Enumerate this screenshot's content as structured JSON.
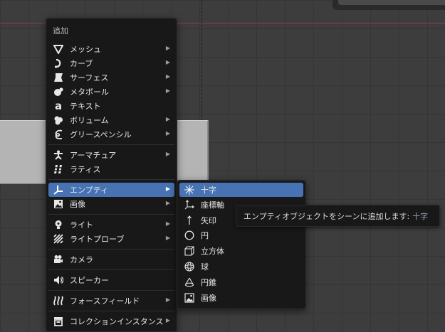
{
  "menu": {
    "title": "追加",
    "items": [
      {
        "label": "メッシュ",
        "icon": "mesh-icon",
        "submenu": true
      },
      {
        "label": "カーブ",
        "icon": "curve-icon",
        "submenu": true
      },
      {
        "label": "サーフェス",
        "icon": "surface-icon",
        "submenu": true
      },
      {
        "label": "メタボール",
        "icon": "metaball-icon",
        "submenu": true
      },
      {
        "label": "テキスト",
        "icon": "text-icon",
        "submenu": false
      },
      {
        "label": "ボリューム",
        "icon": "volume-icon",
        "submenu": true
      },
      {
        "label": "グリースペンシル",
        "icon": "grease-pencil-icon",
        "submenu": true
      },
      {
        "label": "アーマチュア",
        "icon": "armature-icon",
        "submenu": true
      },
      {
        "label": "ラティス",
        "icon": "lattice-icon",
        "submenu": false
      },
      {
        "label": "エンプティ",
        "icon": "empty-icon",
        "submenu": true,
        "active": true
      },
      {
        "label": "画像",
        "icon": "image-icon",
        "submenu": true
      },
      {
        "label": "ライト",
        "icon": "light-icon",
        "submenu": true
      },
      {
        "label": "ライトプローブ",
        "icon": "light-probe-icon",
        "submenu": true
      },
      {
        "label": "カメラ",
        "icon": "camera-icon",
        "submenu": false
      },
      {
        "label": "スピーカー",
        "icon": "speaker-icon",
        "submenu": false
      },
      {
        "label": "フォースフィールド",
        "icon": "force-field-icon",
        "submenu": true
      },
      {
        "label": "コレクションインスタンス",
        "icon": "collection-instance-icon",
        "submenu": true
      }
    ]
  },
  "submenu": {
    "items": [
      {
        "label": "十字",
        "icon": "plain-axes-icon",
        "active": true
      },
      {
        "label": "座標軸",
        "icon": "arrows-icon"
      },
      {
        "label": "矢印",
        "icon": "single-arrow-icon"
      },
      {
        "label": "円",
        "icon": "circle-icon"
      },
      {
        "label": "立方体",
        "icon": "cube-icon"
      },
      {
        "label": "球",
        "icon": "sphere-icon"
      },
      {
        "label": "円錐",
        "icon": "cone-icon"
      },
      {
        "label": "画像",
        "icon": "image-icon"
      }
    ]
  },
  "tooltip": {
    "text": "エンプティオブジェクトをシーンに追加します:",
    "value": "十字"
  },
  "colors": {
    "menu_bg": "#181818",
    "highlight": "#4772b3",
    "viewport_bg": "#3d3d3d",
    "x_axis": "#9a3a44"
  }
}
